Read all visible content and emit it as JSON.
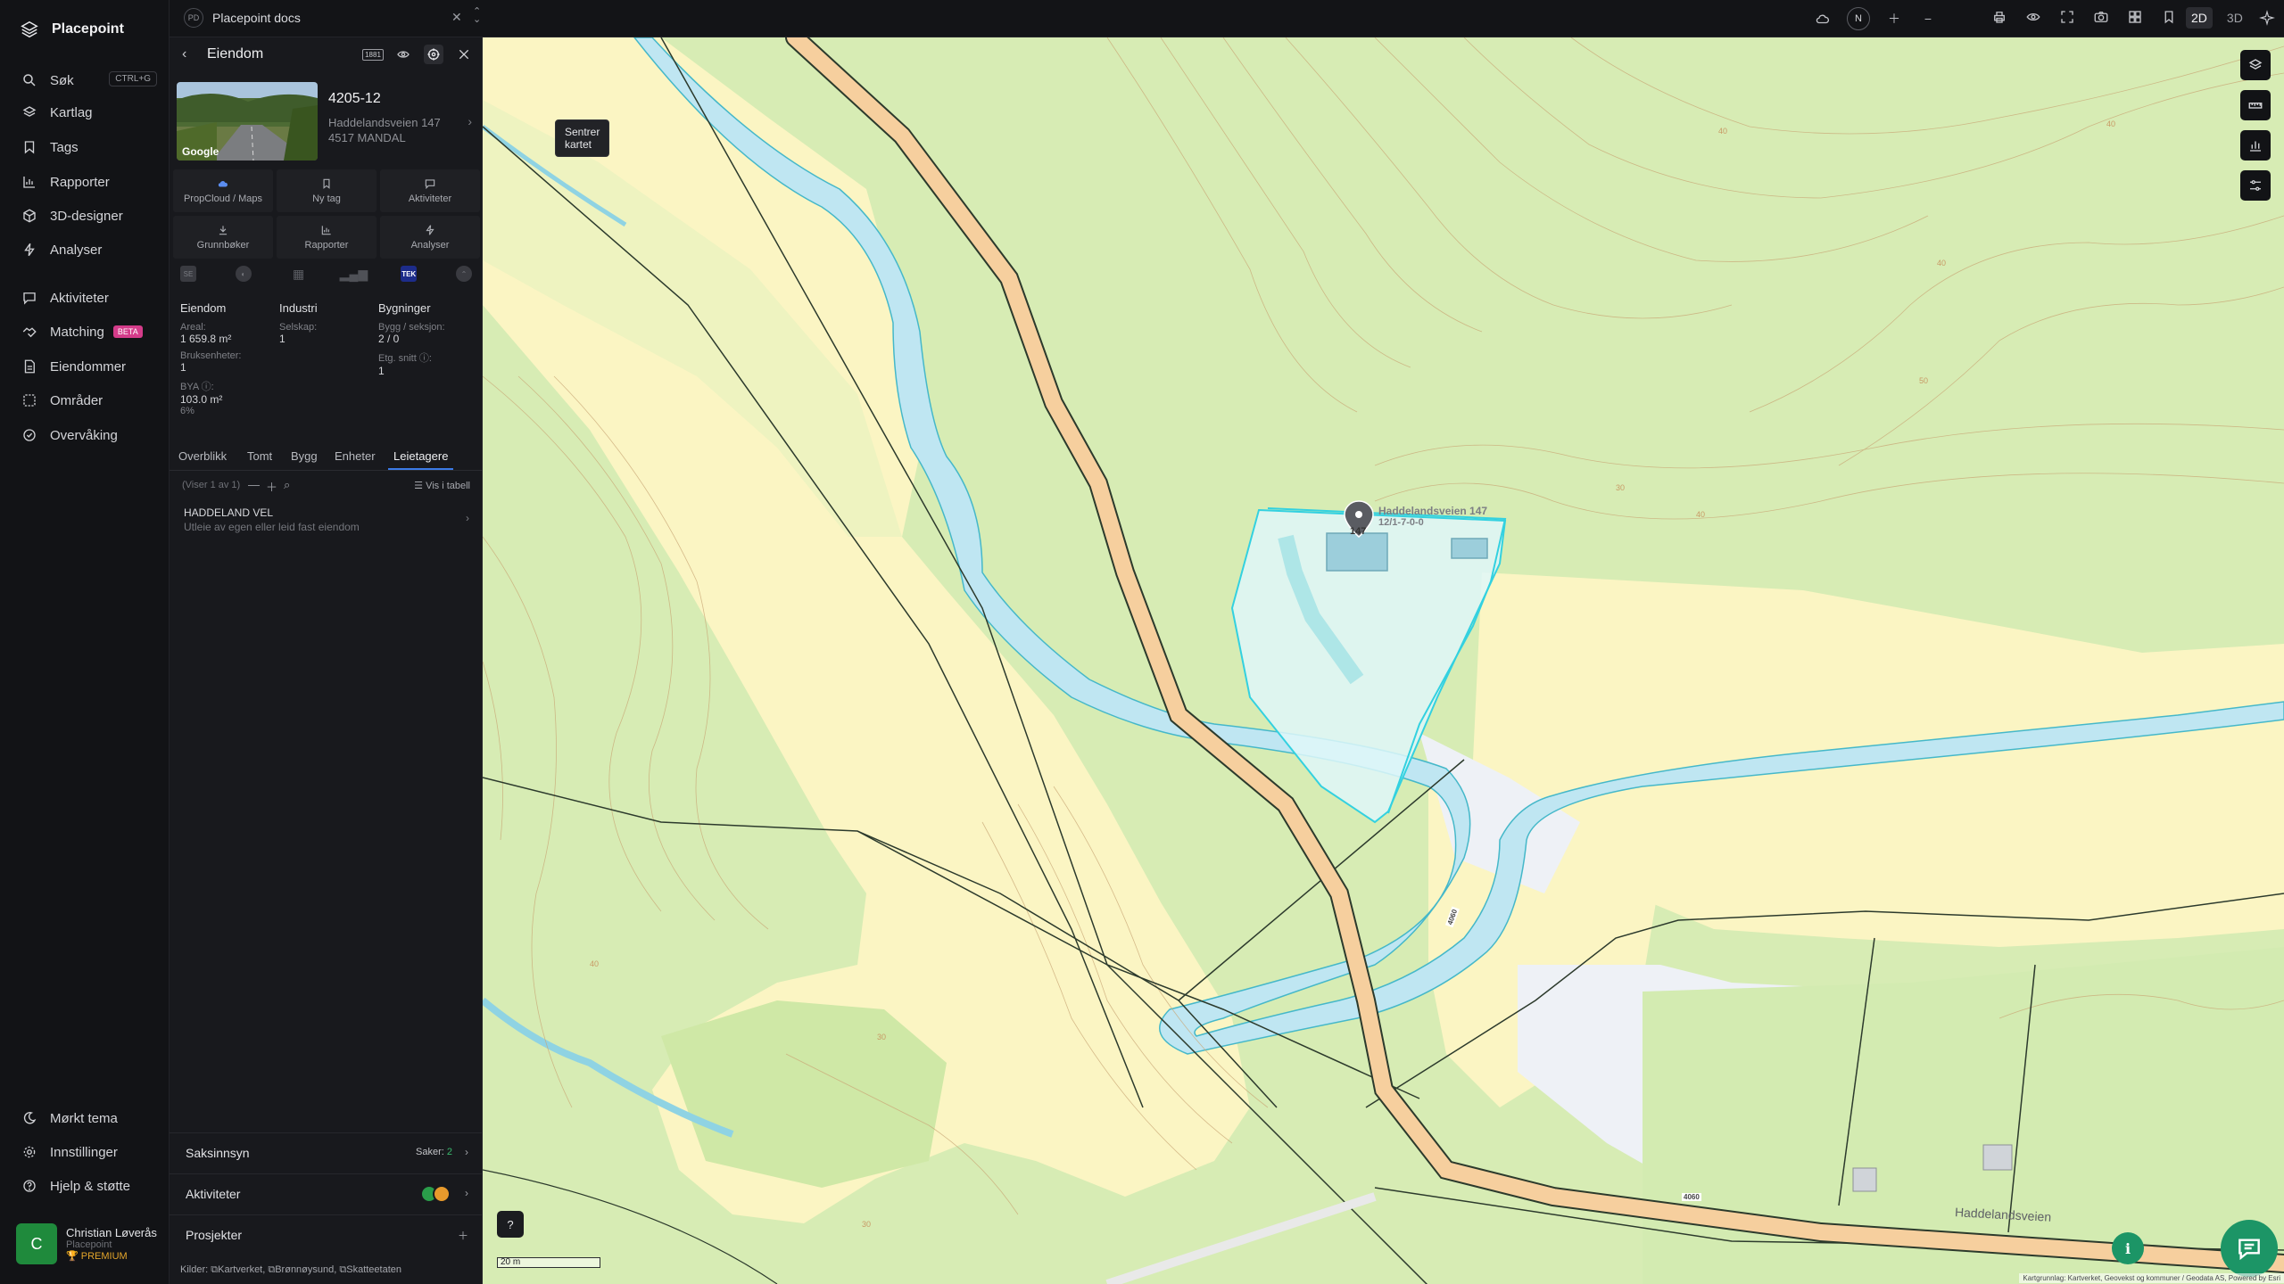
{
  "app": {
    "name": "Placepoint"
  },
  "nav": {
    "items": [
      {
        "label": "Søk",
        "shortcut": "CTRL+G",
        "icon": "search-icon"
      },
      {
        "label": "Kartlag",
        "icon": "layers-icon"
      },
      {
        "label": "Tags",
        "icon": "bookmark-icon"
      },
      {
        "label": "Rapporter",
        "icon": "chart-icon"
      },
      {
        "label": "3D-designer",
        "icon": "cube-icon"
      },
      {
        "label": "Analyser",
        "icon": "bolt-icon"
      },
      {
        "label": "Aktiviteter",
        "icon": "chat-icon"
      },
      {
        "label": "Matching",
        "badge": "BETA",
        "icon": "handshake-icon"
      },
      {
        "label": "Eiendommer",
        "icon": "document-icon"
      },
      {
        "label": "Områder",
        "icon": "area-icon"
      },
      {
        "label": "Overvåking",
        "icon": "check-circle-icon"
      }
    ],
    "bottom": [
      {
        "label": "Mørkt tema",
        "icon": "moon-icon"
      },
      {
        "label": "Innstillinger",
        "icon": "gear-icon"
      },
      {
        "label": "Hjelp & støtte",
        "icon": "help-icon"
      }
    ],
    "user": {
      "initial": "C",
      "name": "Christian Løverås",
      "org": "Placepoint",
      "plan": "PREMIUM"
    }
  },
  "workspace": {
    "badge": "PD",
    "title": "Placepoint docs"
  },
  "toolbar": {
    "compass": "N",
    "mode_2d": "2D",
    "mode_3d": "3D"
  },
  "panel": {
    "title": "Eiendom",
    "badge_1881": "1881",
    "tooltip": "Sentrer kartet",
    "property": {
      "id": "4205-12",
      "address": "Haddelandsveien 147",
      "city": "4517 MANDAL",
      "thumb_logo": "Google"
    },
    "actions": [
      "PropCloud / Maps",
      "Ny tag",
      "Aktiviteter",
      "Grunnbøker",
      "Rapporter",
      "Analyser"
    ],
    "source_tek": "TEK",
    "facts": {
      "eiendom": {
        "heading": "Eiendom",
        "areal_label": "Areal:",
        "areal_value": "1 659.8 m²",
        "bruk_label": "Bruksenheter:",
        "bruk_value": "1",
        "bya_label": "BYA ⓘ:",
        "bya_value": "103.0 m²",
        "bya_pct": "6%"
      },
      "industri": {
        "heading": "Industri",
        "selskap_label": "Selskap:",
        "selskap_value": "1"
      },
      "bygninger": {
        "heading": "Bygninger",
        "bygg_label": "Bygg / seksjon:",
        "bygg_value": "2 / 0",
        "etg_label": "Etg. snitt ⓘ:",
        "etg_value": "1"
      }
    },
    "tabs": [
      "Overblikk",
      "Tomt",
      "Bygg",
      "Enheter",
      "Leietagere"
    ],
    "list": {
      "count": "(Viser 1 av 1)",
      "table_label": "Vis i tabell"
    },
    "lessee": {
      "name": "HADDELAND VEL",
      "desc": "Utleie av egen eller leid fast eiendom"
    },
    "sections": {
      "saksinnsyn": {
        "label": "Saksinnsyn",
        "saker_label": "Saker:",
        "saker_value": "2"
      },
      "aktiviteter": {
        "label": "Aktiviteter"
      },
      "prosjekter": {
        "label": "Prosjekter"
      }
    },
    "kilder": {
      "label": "Kilder:",
      "items": [
        "Kartverket,",
        "Brønnøysund,",
        "Skatteetaten"
      ]
    }
  },
  "map": {
    "marker_number": "147",
    "marker_address": "Haddelandsveien 147",
    "marker_gnr": "12/1-7-0-0",
    "road_label": "Haddelandsveien",
    "road_number": "4060",
    "road_number_b": "4060",
    "scale": "20 m",
    "attribution": "Kartgrunnlag: Kartverket, Geovekst og kommuner / Geodata AS, Powered by Esri",
    "contours": [
      "40",
      "40",
      "50",
      "40",
      "30",
      "40",
      "30",
      "30",
      "40"
    ],
    "colors": {
      "forest": "#d7ecb4",
      "farmland": "#fbf5c3",
      "river": "#bfe6f2",
      "road": "#f6cf9e",
      "parcel": "#33d1e0"
    }
  }
}
